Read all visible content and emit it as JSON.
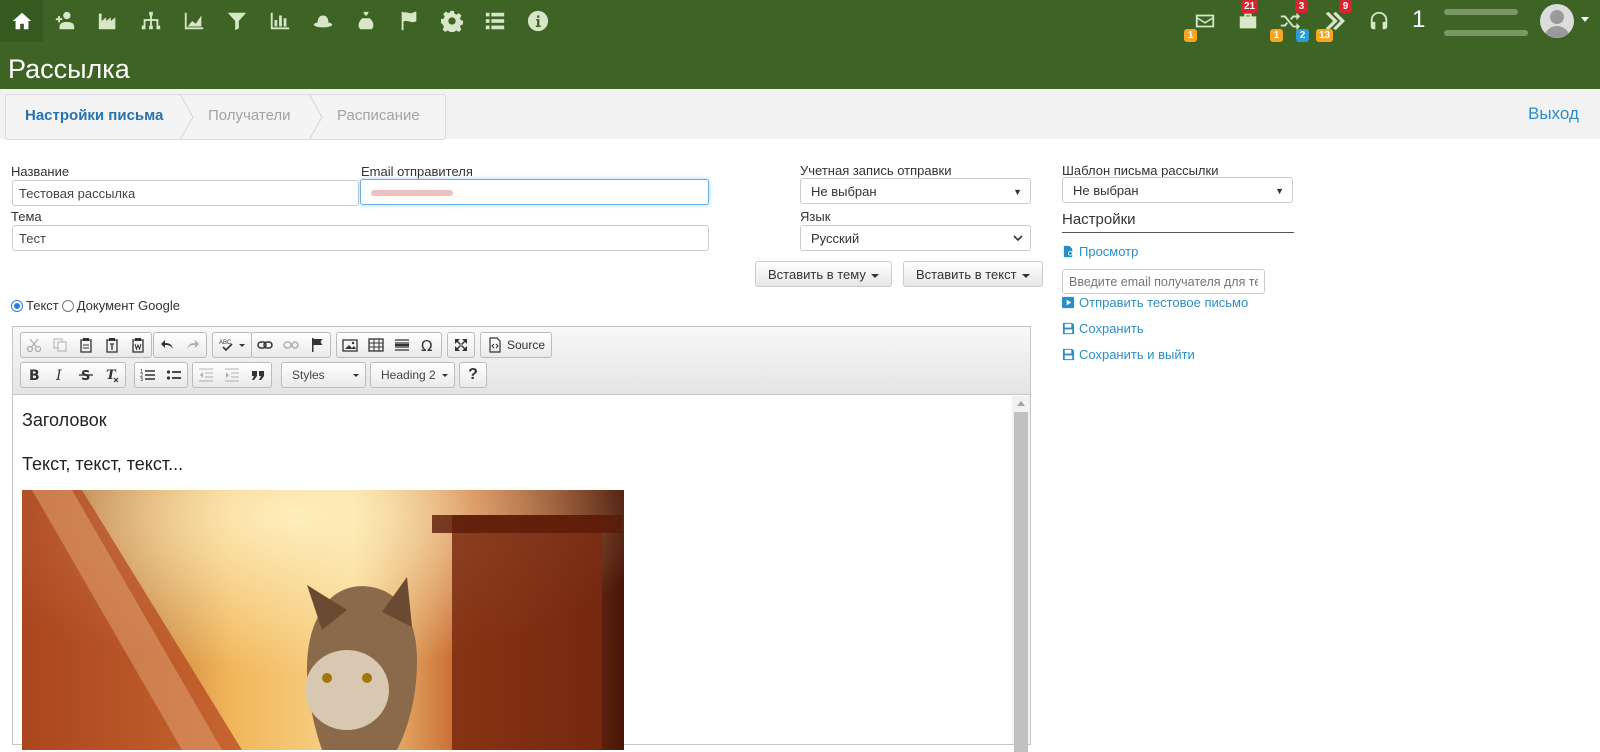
{
  "nav": {
    "badges": {
      "mail": "1",
      "briefcase": "21",
      "briefcase_sub": "1",
      "shuffle": "3",
      "shuffle_sub": "2",
      "arrows": "9",
      "arrows_sub": "13"
    },
    "user_count": "1"
  },
  "page": {
    "title": "Рассылка"
  },
  "wizard": {
    "steps": [
      "Настройки письма",
      "Получатели",
      "Расписание"
    ],
    "logout": "Выход"
  },
  "form": {
    "name_label": "Название",
    "name_value": "Тестовая рассылка",
    "sender_label": "Email отправителя",
    "subject_label": "Тема",
    "subject_value": "Тест",
    "account_label": "Учетная запись отправки",
    "account_value": "Не выбран",
    "language_label": "Язык",
    "language_value": "Русский",
    "insert_subject": "Вставить в тему",
    "insert_text": "Вставить в текст",
    "radio_text": "Текст",
    "radio_google": "Документ Google"
  },
  "editor": {
    "source_label": "Source",
    "styles_label": "Styles",
    "format_label": "Heading 2",
    "help_label": "?",
    "heading": "Заголовок",
    "paragraph": "Текст, текст, текст..."
  },
  "sidebar": {
    "template_label": "Шаблон письма рассылки",
    "template_value": "Не выбран",
    "settings_title": "Настройки",
    "preview": "Просмотр",
    "test_email_placeholder": "Введите email получателя для тестового письма",
    "send_test": "Отправить тестовое письмо",
    "save": "Сохранить",
    "save_exit": "Сохранить и выйти"
  },
  "colors": {
    "header": "#3e6425",
    "link": "#2a8fc8",
    "active_step": "#2873ae"
  }
}
